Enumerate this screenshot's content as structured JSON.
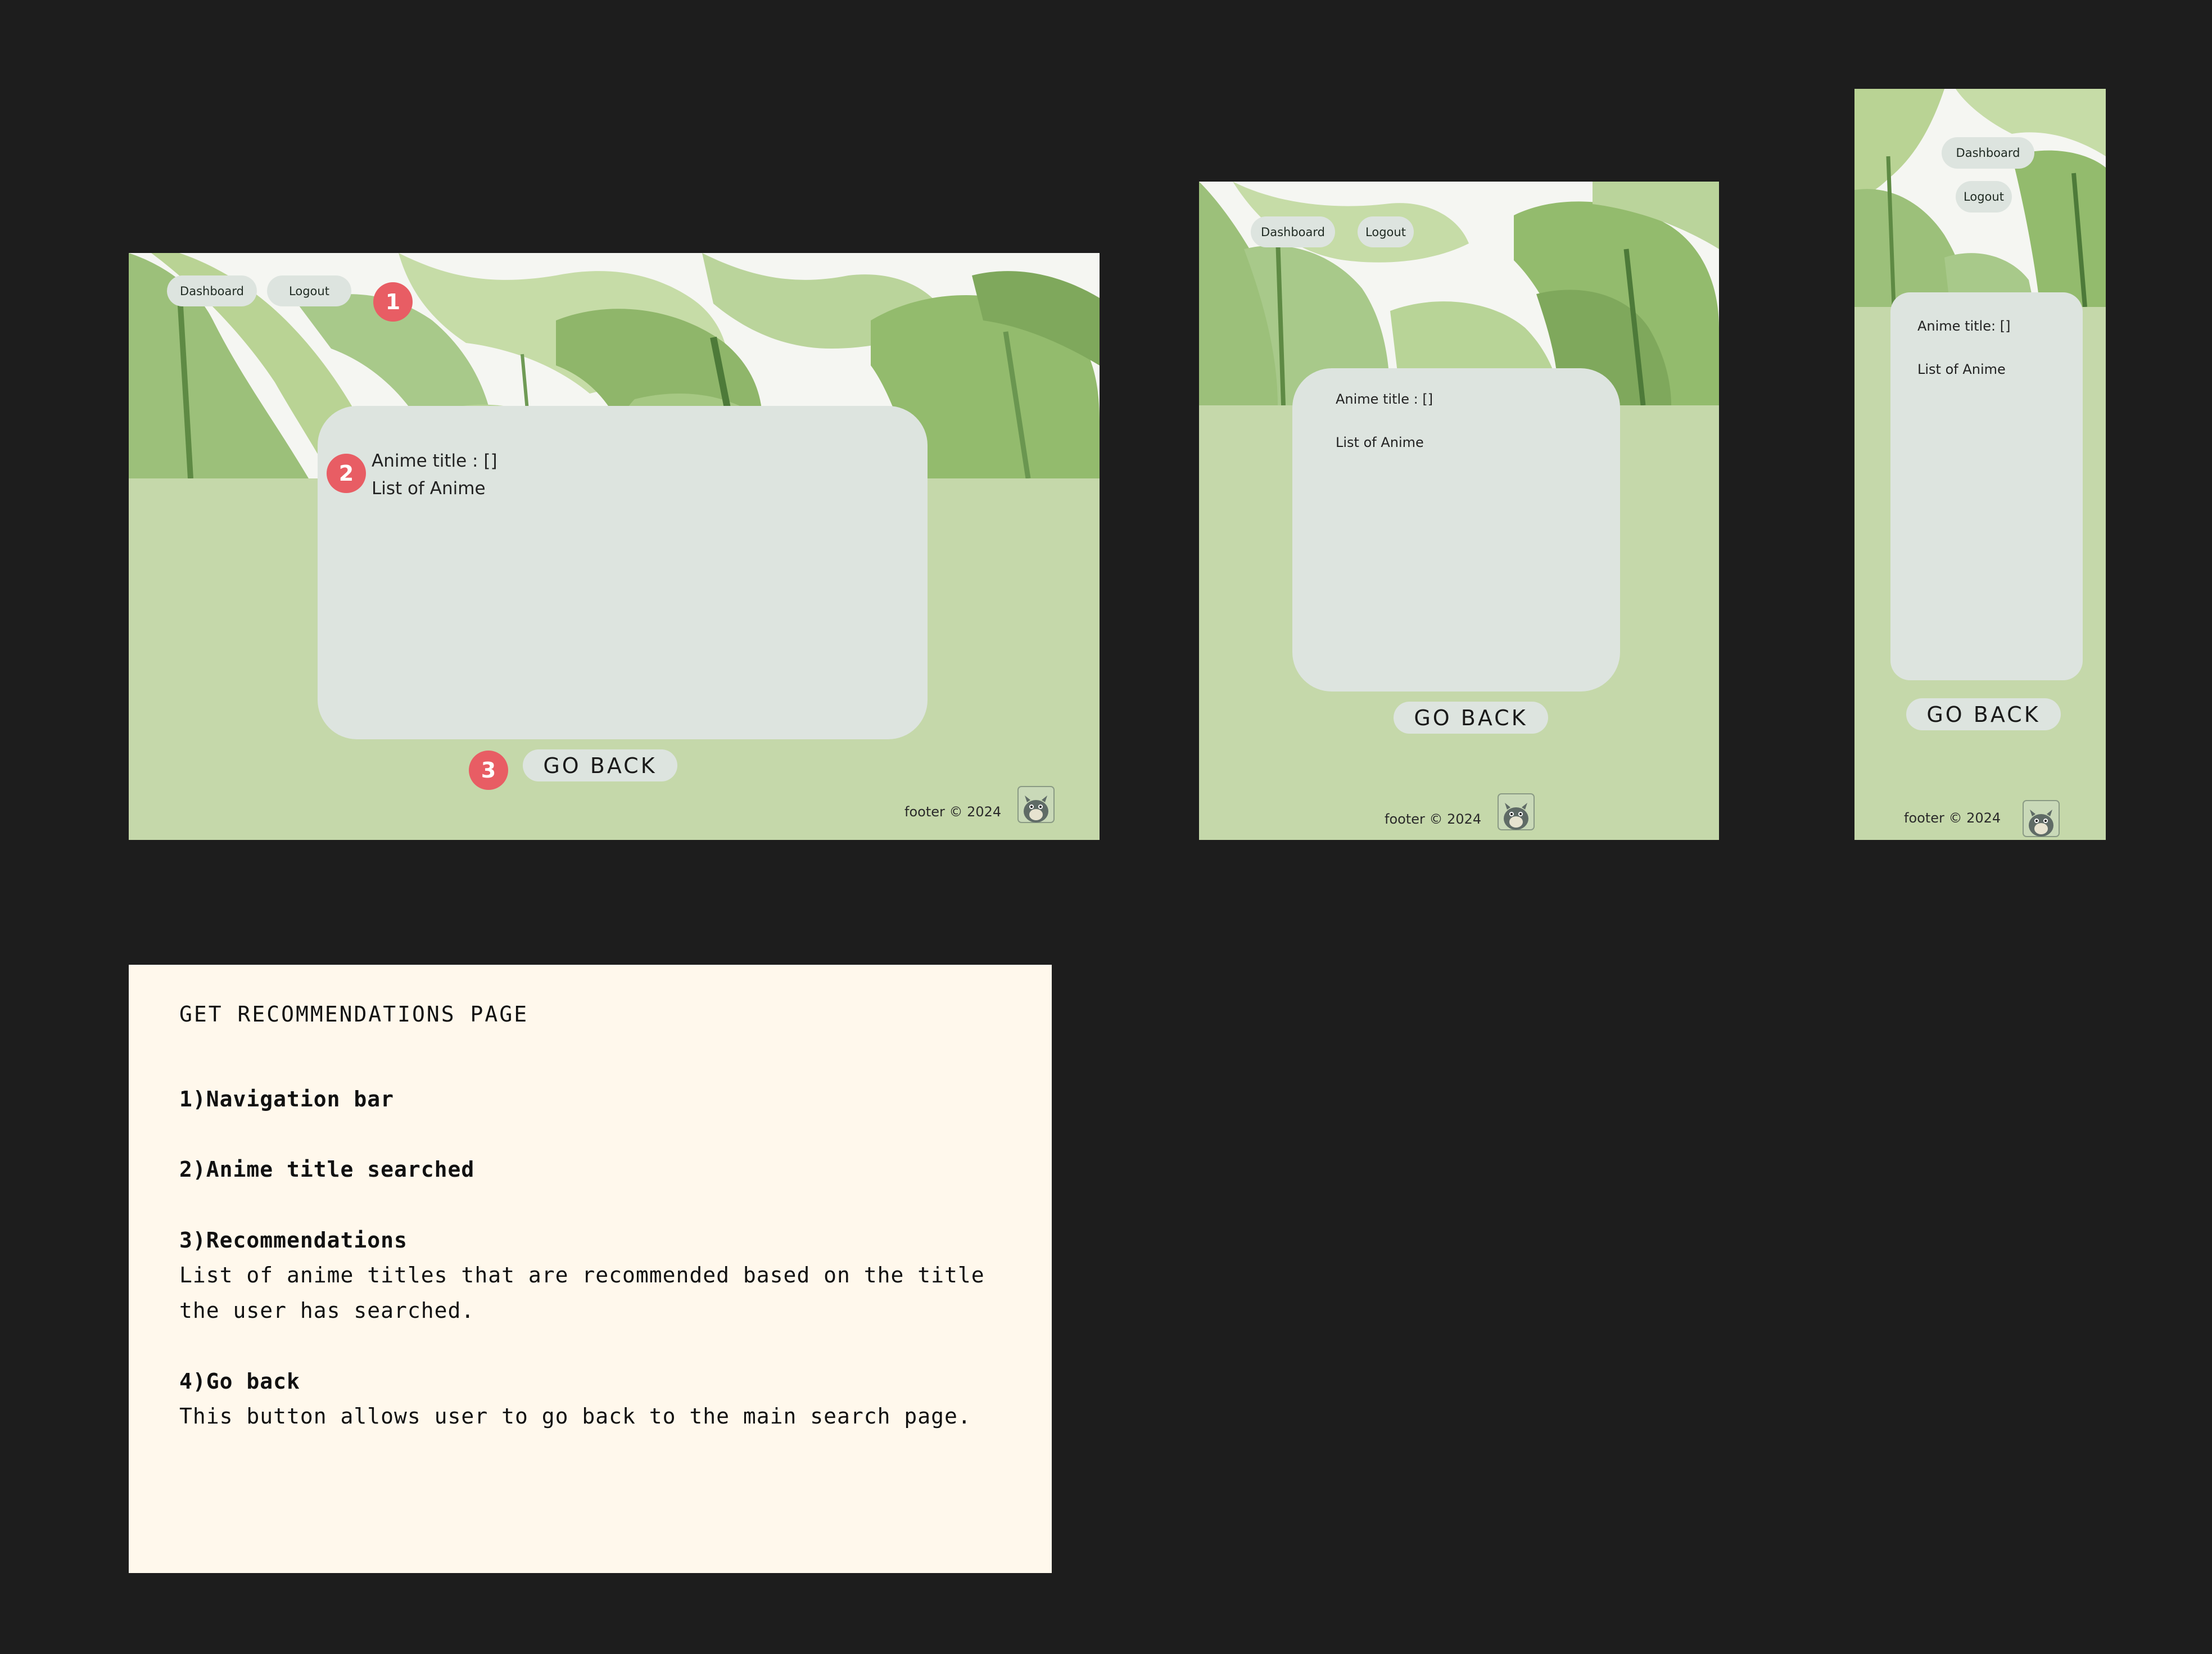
{
  "page_title": "GET RECOMMENDATIONS PAGE",
  "nav": {
    "dashboard_label": "Dashboard",
    "logout_label": "Logout"
  },
  "content": {
    "anime_title_label": "Anime title : []",
    "anime_title_label_mobile": "Anime title: []",
    "list_label": "List of Anime"
  },
  "go_back_label": "GO BACK",
  "footer": {
    "text": "footer © 2024"
  },
  "markers": [
    "1",
    "2",
    "3"
  ],
  "notes": {
    "title": "GET RECOMMENDATIONS PAGE",
    "items": [
      {
        "heading": "1)Navigation bar",
        "description": ""
      },
      {
        "heading": "2)Anime title searched",
        "description": ""
      },
      {
        "heading": "3)Recommendations",
        "description": "List of anime titles that are recommended based on the title the user has searched."
      },
      {
        "heading": "4)Go back",
        "description": "This button allows user to go back to the main search page."
      }
    ]
  },
  "colors": {
    "background": "#1d1d1d",
    "page_green": "#c5d8aa",
    "card": "#dde4df",
    "marker": "#e85d64",
    "notes_bg": "#fff8ec"
  },
  "icons": [
    "leaf-banner-image",
    "totoro-mascot-icon"
  ]
}
